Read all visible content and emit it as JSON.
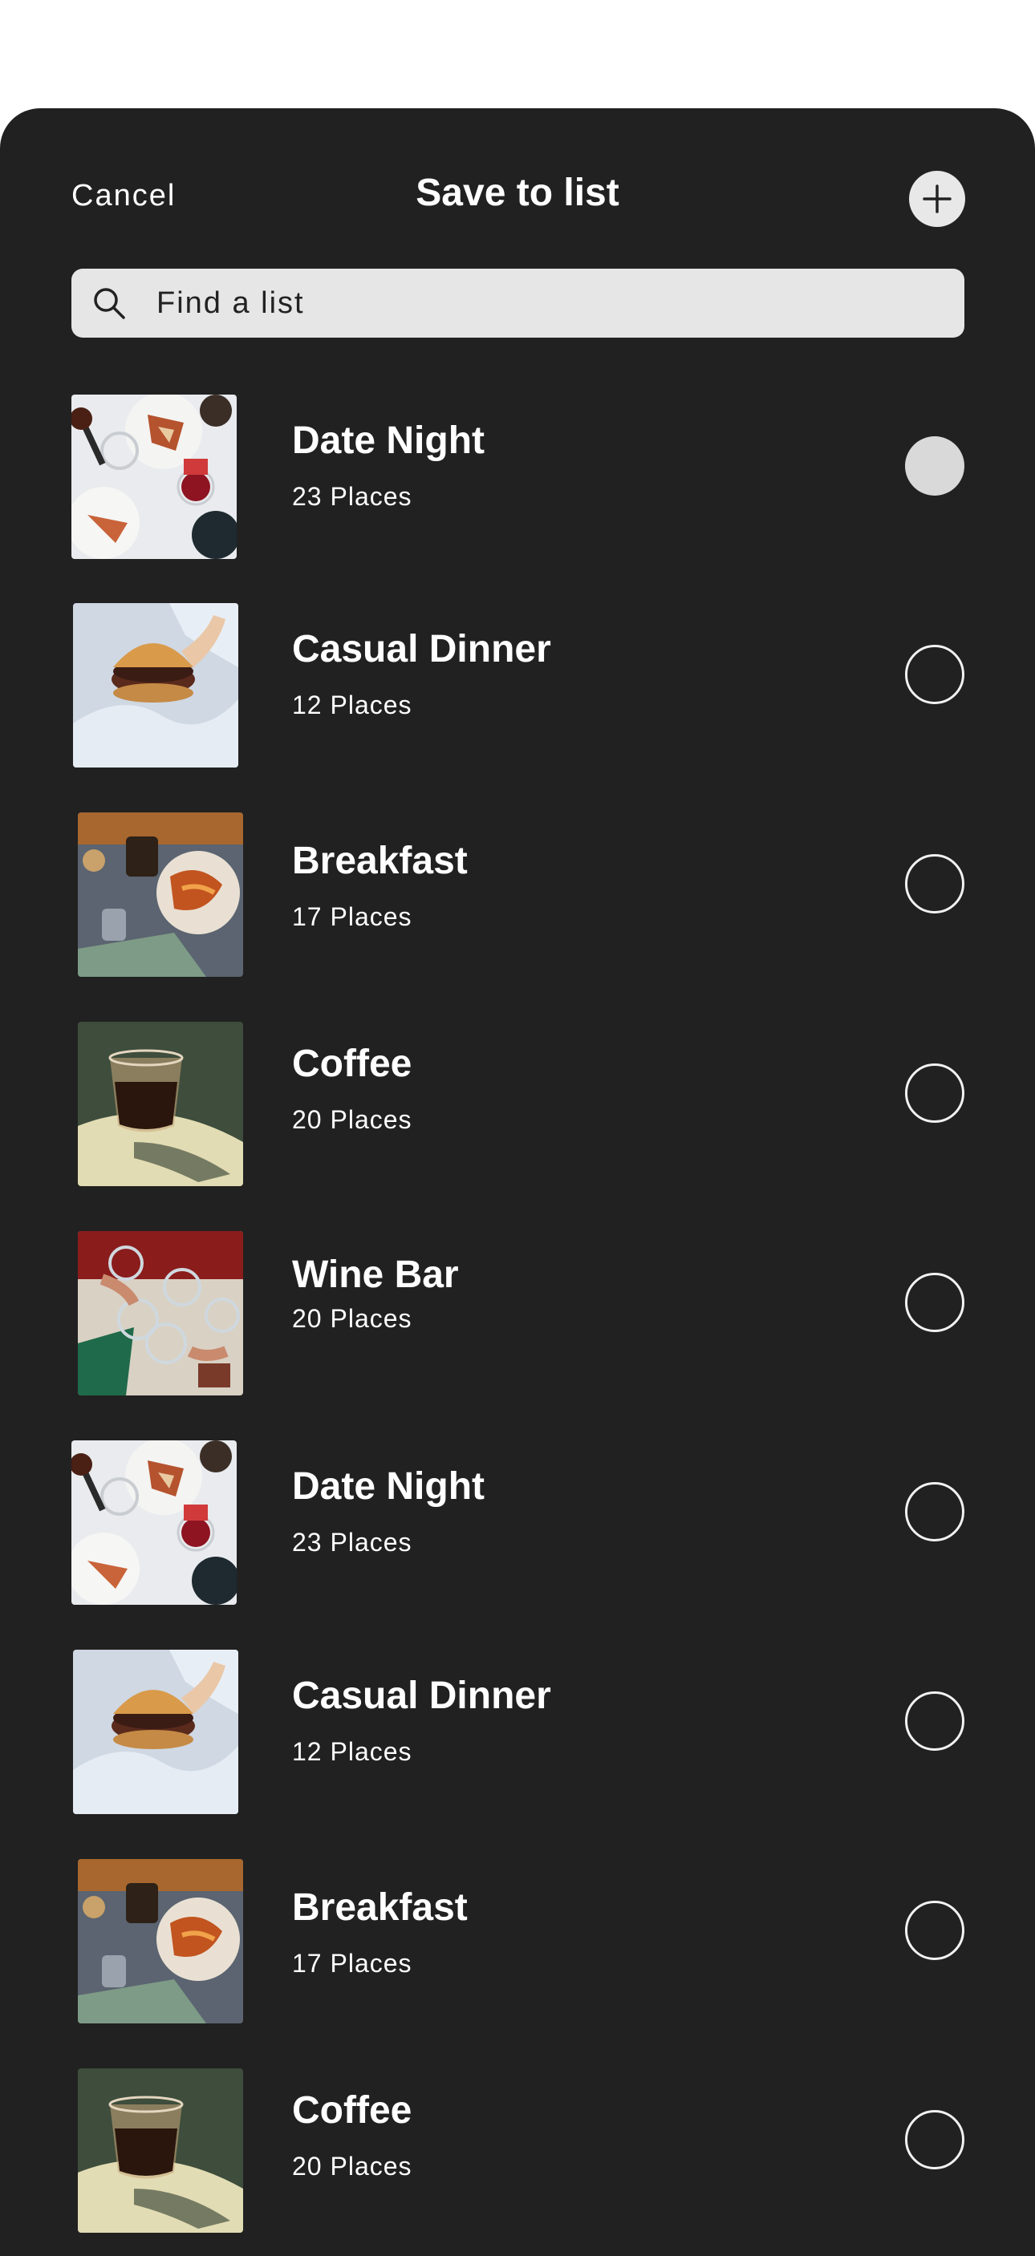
{
  "header": {
    "cancel_label": "Cancel",
    "title": "Save to list",
    "add_icon": "plus-icon"
  },
  "search": {
    "placeholder": "Find a list",
    "value": "",
    "icon": "search-icon"
  },
  "lists": [
    {
      "name": "Date Night",
      "count": "23 Places",
      "thumbnail": "date-night-table-photo",
      "selected": true
    },
    {
      "name": "Casual Dinner",
      "count": "12 Places",
      "thumbnail": "burger-photo",
      "selected": false
    },
    {
      "name": "Breakfast",
      "count": "17 Places",
      "thumbnail": "breakfast-photo",
      "selected": false
    },
    {
      "name": "Coffee",
      "count": "20 Places",
      "thumbnail": "coffee-glass-photo",
      "selected": false
    },
    {
      "name": "Wine Bar",
      "count": "20 Places",
      "thumbnail": "wine-toast-photo",
      "selected": false
    },
    {
      "name": "Date Night",
      "count": "23 Places",
      "thumbnail": "date-night-table-photo",
      "selected": false
    },
    {
      "name": "Casual Dinner",
      "count": "12 Places",
      "thumbnail": "burger-photo",
      "selected": false
    },
    {
      "name": "Breakfast",
      "count": "17 Places",
      "thumbnail": "breakfast-photo",
      "selected": false
    },
    {
      "name": "Coffee",
      "count": "20 Places",
      "thumbnail": "coffee-glass-photo",
      "selected": false
    }
  ],
  "colors": {
    "sheet_background": "#212121",
    "search_background": "#e6e6e6",
    "selected_radio": "#d9d9d9",
    "text": "#ffffff"
  }
}
